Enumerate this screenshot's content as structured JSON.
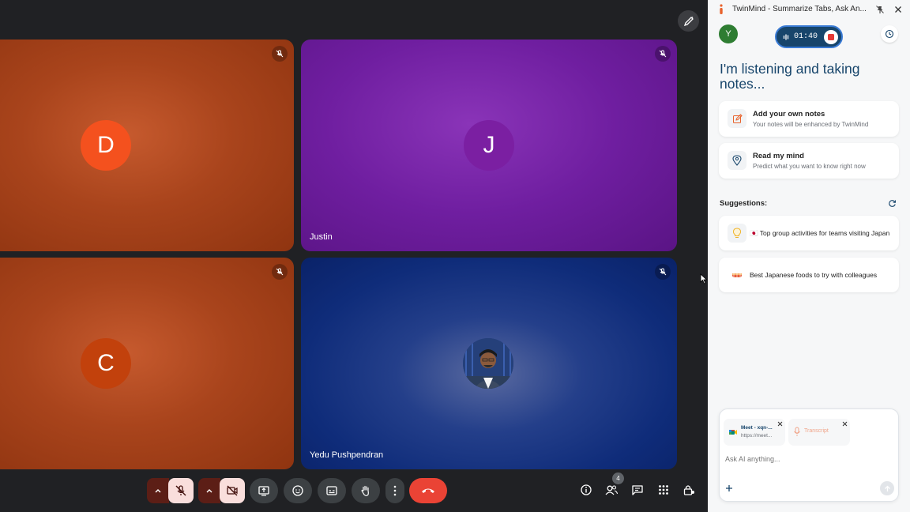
{
  "meet": {
    "tiles": [
      {
        "initial": "D",
        "name": "",
        "avatar_color": "#f4511e"
      },
      {
        "initial": "J",
        "name": "Justin",
        "avatar_color": "#7b1fa2"
      },
      {
        "initial": "C",
        "name": "",
        "avatar_color": "#c2410c"
      },
      {
        "initial": "",
        "name": "Yedu Pushpendran",
        "avatar_color": "#1e3a8a"
      }
    ],
    "participants_count": "4"
  },
  "panel": {
    "title": "TwinMind - Summarize Tabs, Ask An...",
    "user_initial": "Y",
    "timer": "01:40",
    "heading": "I'm listening and taking notes...",
    "cards": [
      {
        "title": "Add your own notes",
        "subtitle": "Your notes will be enhanced by TwinMind"
      },
      {
        "title": "Read my mind",
        "subtitle": "Predict what you want to know right now"
      }
    ],
    "suggestions_label": "Suggestions:",
    "suggestions": [
      {
        "text": "🇯🇵 Top group activities for teams visiting Japan"
      },
      {
        "text": "Best Japanese foods to try with colleagues"
      }
    ],
    "context_chips": [
      {
        "title": "Meet - xqn-...",
        "subtitle": "https://meet..."
      },
      {
        "title": "Transcript",
        "subtitle": ""
      }
    ],
    "ask_placeholder": "Ask AI anything..."
  },
  "colors": {
    "accent": "#17456b",
    "hangup": "#ea4335",
    "muted_btn": "#f9dedc"
  }
}
